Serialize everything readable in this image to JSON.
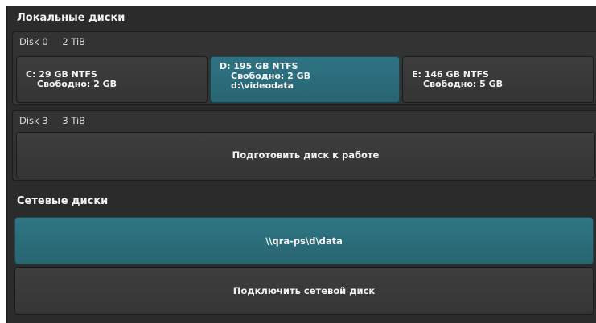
{
  "local_section": {
    "title": "Локальные диски"
  },
  "disks": [
    {
      "name": "Disk 0",
      "size": "2 TiB",
      "partitions": [
        {
          "line1": "C: 29 GB NTFS",
          "line2": "Свободно: 2 GB",
          "line3": ""
        },
        {
          "line1": "D: 195 GB NTFS",
          "line2": "Свободно: 2 GB",
          "line3": "d:\\videodata"
        },
        {
          "line1": "E: 146 GB NTFS",
          "line2": "Свободно: 5 GB",
          "line3": ""
        }
      ]
    },
    {
      "name": "Disk 3",
      "size": "3 TiB",
      "prepare_label": "Подготовить диск к работе"
    }
  ],
  "network_section": {
    "title": "Сетевые диски",
    "share_path": "\\\\qra-ps\\d\\data",
    "connect_label": "Подключить сетевой диск"
  },
  "colors": {
    "panel": "#2b2b2b",
    "accent_teal": "#2e7383"
  }
}
